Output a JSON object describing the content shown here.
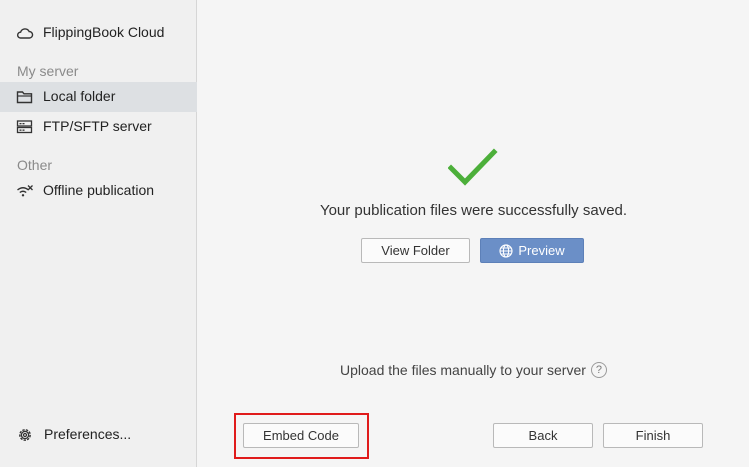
{
  "sidebar": {
    "cloud_label": "FlippingBook Cloud",
    "my_server_header": "My server",
    "local_folder_label": "Local folder",
    "ftp_label": "FTP/SFTP server",
    "other_header": "Other",
    "offline_label": "Offline publication",
    "preferences_label": "Preferences...",
    "active_item": "Local folder"
  },
  "main": {
    "success_message": "Your publication files were successfully saved.",
    "view_folder_label": "View Folder",
    "preview_label": "Preview",
    "upload_note": "Upload the files manually to your server",
    "help_symbol": "?"
  },
  "footer": {
    "embed_code_label": "Embed Code",
    "back_label": "Back",
    "finish_label": "Finish"
  },
  "colors": {
    "accent": "#6b8fc7",
    "success": "#4caf3a",
    "highlight": "#e01b1b",
    "sidebar_bg": "#f0f0f0",
    "active_item_bg": "#dde0e3"
  },
  "icons": {
    "cloud": "cloud-icon",
    "folder": "folder-icon",
    "server": "server-icon",
    "offline": "wifi-off-icon",
    "gear": "gear-icon",
    "check": "checkmark-icon",
    "globe": "globe-icon",
    "help": "question-circle-icon"
  }
}
